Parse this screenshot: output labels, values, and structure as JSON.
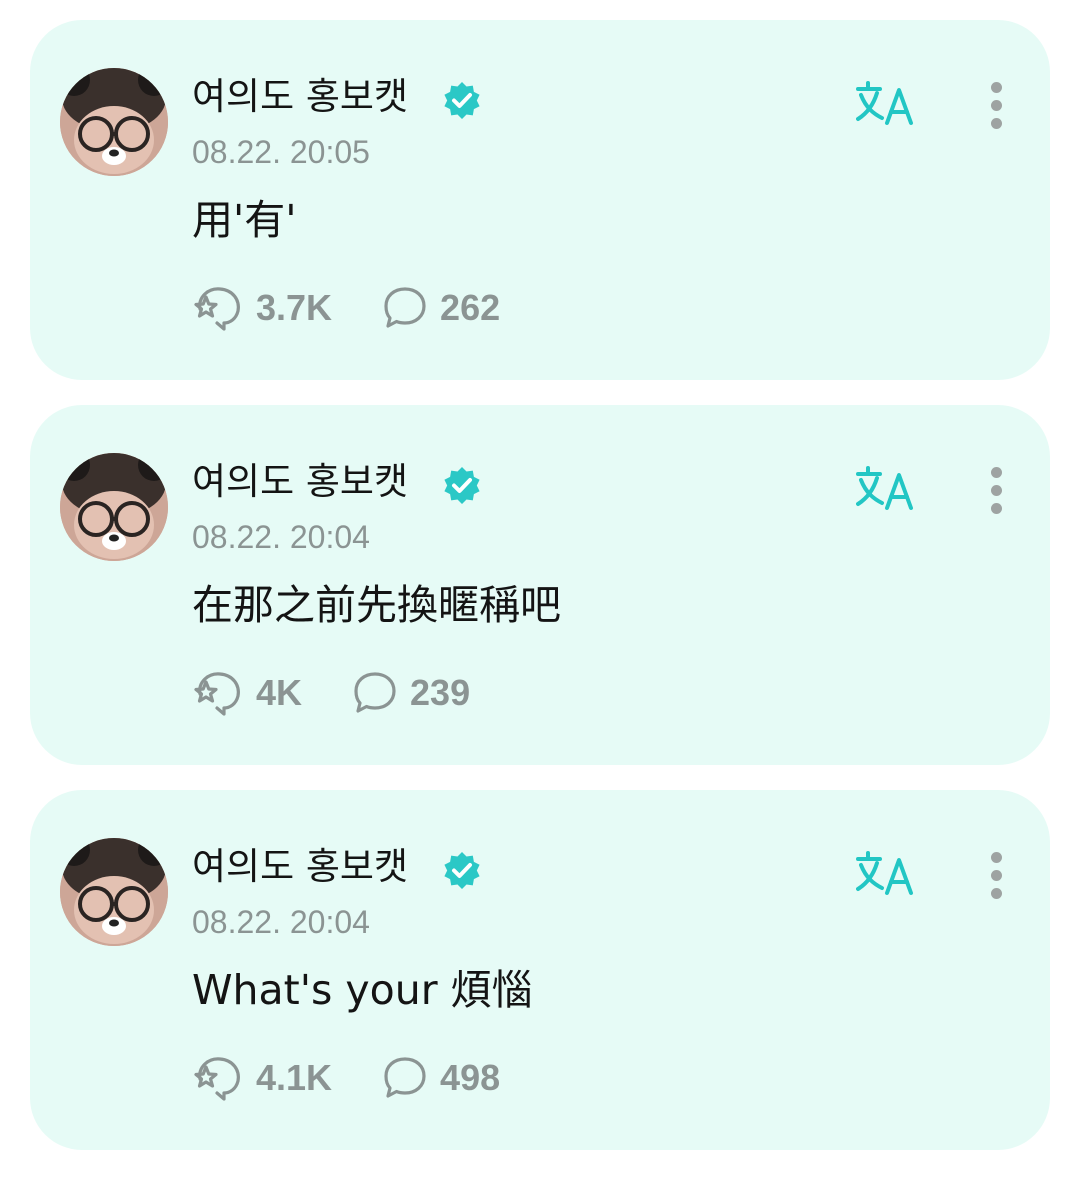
{
  "posts": [
    {
      "author": "여의도 홍보캣",
      "time": "08.22. 20:05",
      "text": "用'有'",
      "likes": "3.7K",
      "comments": "262"
    },
    {
      "author": "여의도 홍보캣",
      "time": "08.22. 20:04",
      "text": "在那之前先換暱稱吧",
      "likes": "4K",
      "comments": "239"
    },
    {
      "author": "여의도 홍보캣",
      "time": "08.22. 20:04",
      "text": "What's your 煩惱",
      "likes": "4.1K",
      "comments": "498"
    }
  ],
  "colors": {
    "card_background": "#e6fbf6",
    "accent": "#22c6c4",
    "muted_text": "#8b9493",
    "primary_text": "#141414"
  },
  "icons": {
    "verified": "verified-badge-icon",
    "translate": "translate-icon",
    "more": "more-vertical-icon",
    "like": "like-icon",
    "comment": "comment-icon"
  }
}
